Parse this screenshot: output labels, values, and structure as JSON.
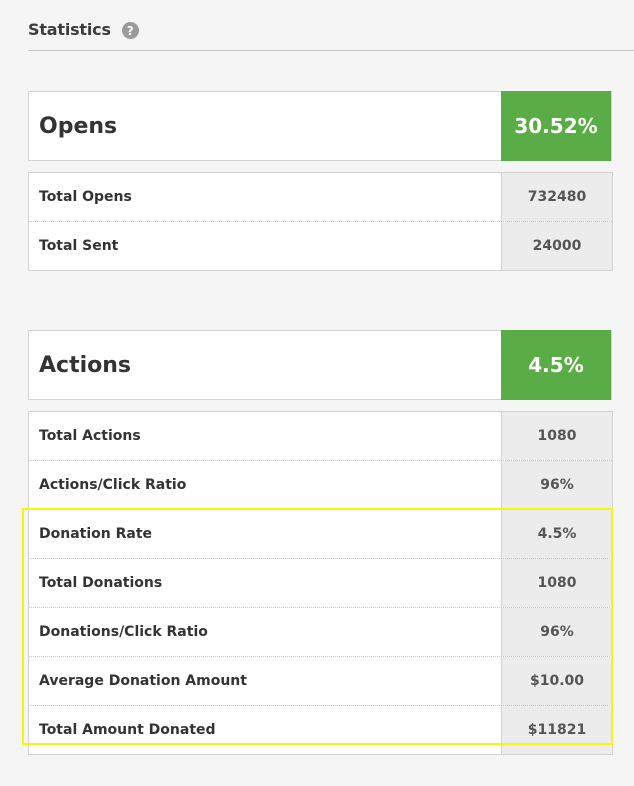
{
  "header": {
    "title": "Statistics",
    "help_icon": "question-circle-icon"
  },
  "colors": {
    "accent_green": "#5aad46",
    "highlight_yellow": "#f5f512"
  },
  "opens": {
    "label": "Opens",
    "value": "30.52%",
    "rows": [
      {
        "label": "Total Opens",
        "value": "732480"
      },
      {
        "label": "Total Sent",
        "value": "24000"
      }
    ]
  },
  "actions": {
    "label": "Actions",
    "value": "4.5%",
    "rows": [
      {
        "label": "Total Actions",
        "value": "1080"
      },
      {
        "label": "Actions/Click Ratio",
        "value": "96%"
      },
      {
        "label": "Donation Rate",
        "value": "4.5%"
      },
      {
        "label": "Total Donations",
        "value": "1080"
      },
      {
        "label": "Donations/Click Ratio",
        "value": "96%"
      },
      {
        "label": "Average Donation Amount",
        "value": "$10.00"
      },
      {
        "label": "Total Amount Donated",
        "value": "$11821"
      }
    ]
  }
}
